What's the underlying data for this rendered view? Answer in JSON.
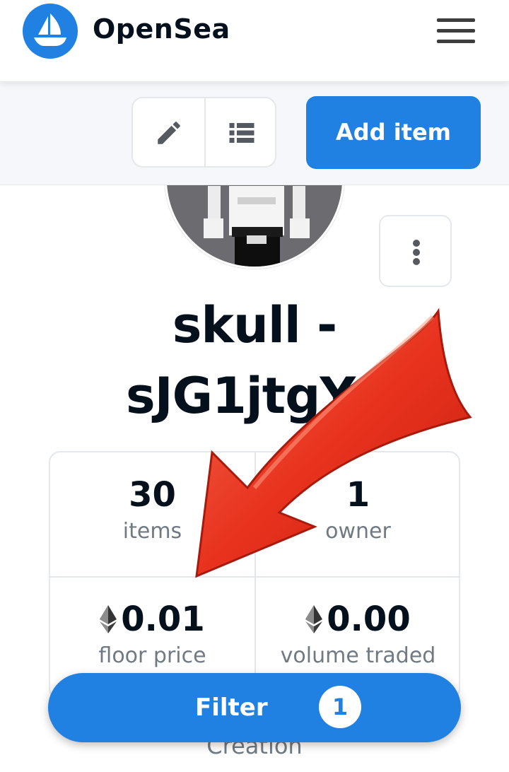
{
  "header": {
    "brand": "OpenSea",
    "logo_icon": "sailboat-icon",
    "menu_icon": "hamburger-menu-icon"
  },
  "toolbar": {
    "edit_icon": "pencil-icon",
    "list_icon": "list-view-icon",
    "add_item_label": "Add item"
  },
  "collection": {
    "title_line1": "skull -",
    "title_line2": "sJG1jtgY",
    "more_icon": "vertical-dots-icon"
  },
  "stats": {
    "items": {
      "value": "30",
      "label": "items"
    },
    "owners": {
      "value": "1",
      "label": "owner"
    },
    "floor": {
      "value": "0.01",
      "label": "floor price"
    },
    "volume": {
      "value": "0.00",
      "label": "volume traded"
    }
  },
  "bottom": {
    "creation_label": "Creation",
    "filter_label": "Filter",
    "filter_count": "1"
  },
  "colors": {
    "brand_blue": "#2081e2",
    "annotation_red": "#e8321e"
  }
}
